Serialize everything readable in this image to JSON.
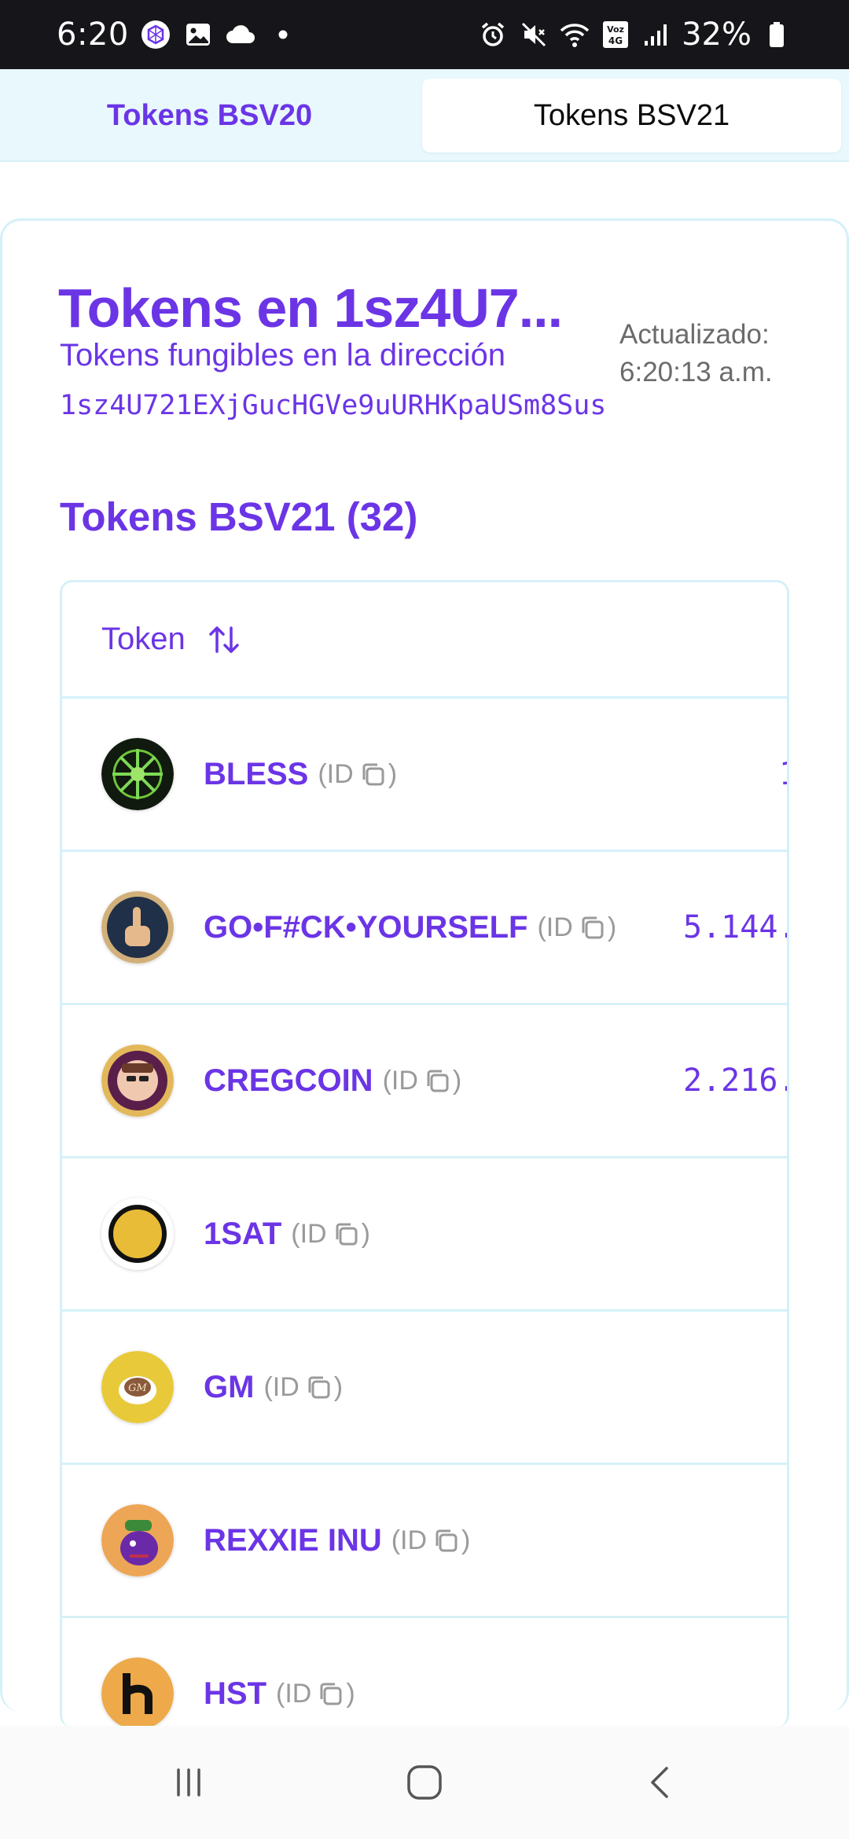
{
  "status_bar": {
    "time": "6:20",
    "battery_text": "32%"
  },
  "tabs": [
    {
      "label": "Tokens BSV20",
      "active": false
    },
    {
      "label": "Tokens BSV21",
      "active": true
    }
  ],
  "header": {
    "title": "Tokens en 1sz4U7...",
    "subtitle": "Tokens fungibles en la dirección",
    "address": "1sz4U721EXjGucHGVe9uURHKpaUSm8Sus",
    "updated_line1": "Actualizado:",
    "updated_line2": "6:20:13 a.m."
  },
  "section": {
    "title": "Tokens BSV21 (32)"
  },
  "table": {
    "column_header": "Token",
    "id_label": "(ID",
    "id_close": ")",
    "rows": [
      {
        "name": "BLESS",
        "amount": "1",
        "avatar": "bless-avatar"
      },
      {
        "name": "GO•F#CK•YOURSELF",
        "amount": "5.144.",
        "avatar": "gofck-avatar"
      },
      {
        "name": "CREGCOIN",
        "amount": "2.216.",
        "avatar": "cregcoin-avatar"
      },
      {
        "name": "1SAT",
        "amount": "",
        "avatar": "1sat-avatar"
      },
      {
        "name": "GM",
        "amount": "",
        "avatar": "gm-avatar"
      },
      {
        "name": "REXXIE INU",
        "amount": "",
        "avatar": "rexxie-avatar"
      },
      {
        "name": "HST",
        "amount": "",
        "avatar": "hst-avatar"
      }
    ]
  },
  "colors": {
    "accent": "#6b35e6",
    "tabbar_bg": "#e8f8fd",
    "border": "#d5f1f8",
    "status_bar_bg": "#16161a"
  }
}
